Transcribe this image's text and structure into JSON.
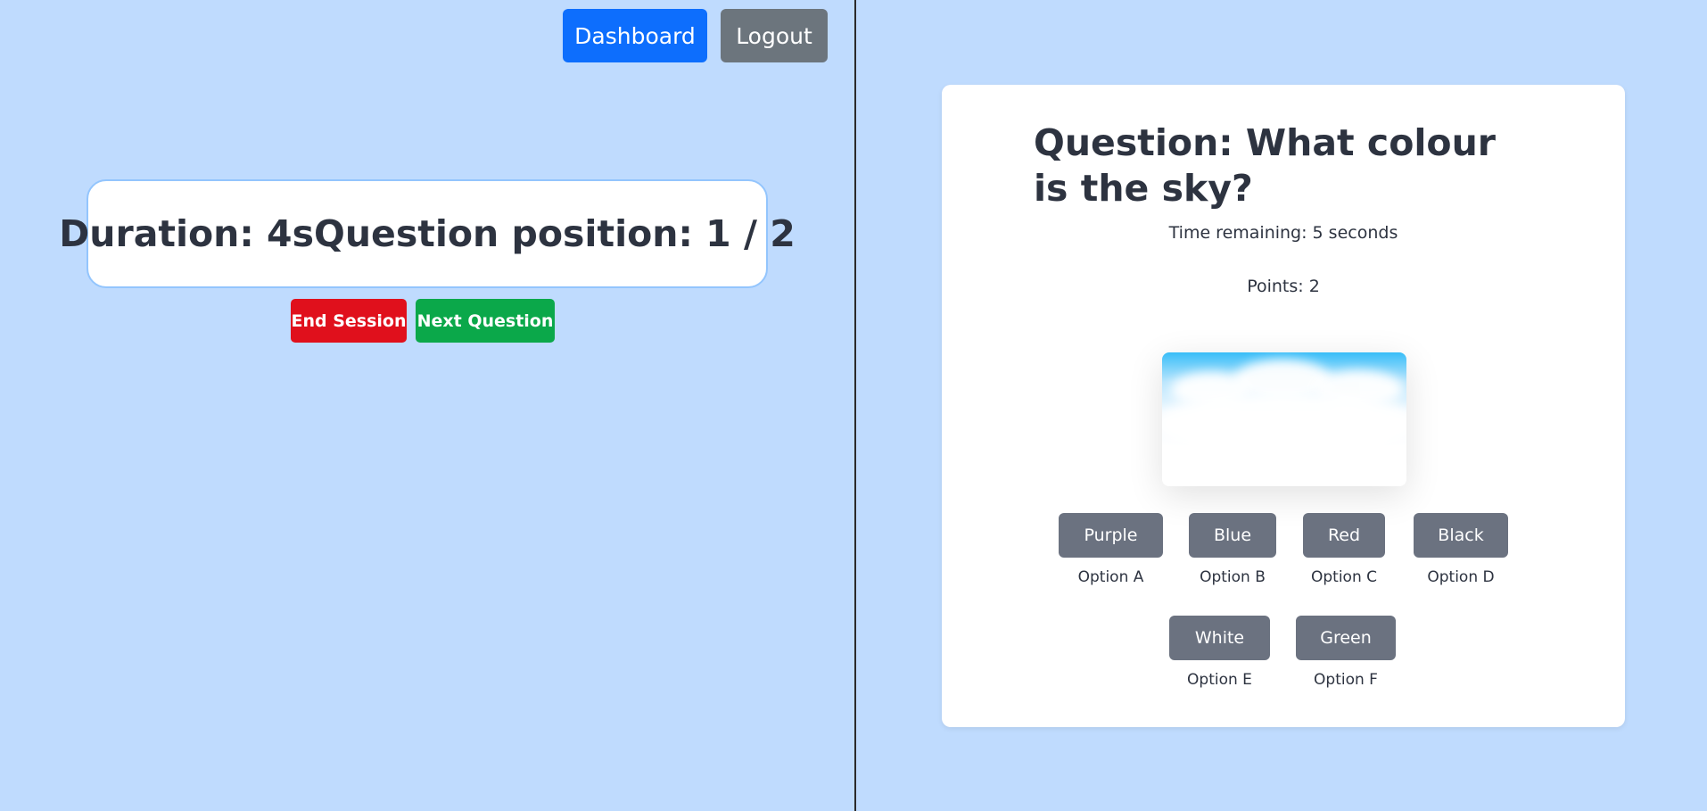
{
  "nav": {
    "dashboard_label": "Dashboard",
    "logout_label": "Logout"
  },
  "session": {
    "duration_text": "Duration: 4s",
    "position_text": "Question position: 1 / 2",
    "end_label": "End Session",
    "next_label": "Next Question"
  },
  "question": {
    "title": "Question: What colour is the sky?",
    "time_remaining": "Time remaining: 5 seconds",
    "points": "Points: 2",
    "image_alt": "sky-image",
    "options": [
      {
        "answer": "Purple",
        "label": "Option A"
      },
      {
        "answer": "Blue",
        "label": "Option B"
      },
      {
        "answer": "Red",
        "label": "Option C"
      },
      {
        "answer": "Black",
        "label": "Option D"
      },
      {
        "answer": "White",
        "label": "Option E"
      },
      {
        "answer": "Green",
        "label": "Option F"
      }
    ]
  },
  "colors": {
    "background": "#bfdbfe",
    "primary": "#0d6efd",
    "secondary": "#6c757d",
    "danger": "#e0101c",
    "success": "#0ba84a",
    "option_button": "#6b7280"
  }
}
